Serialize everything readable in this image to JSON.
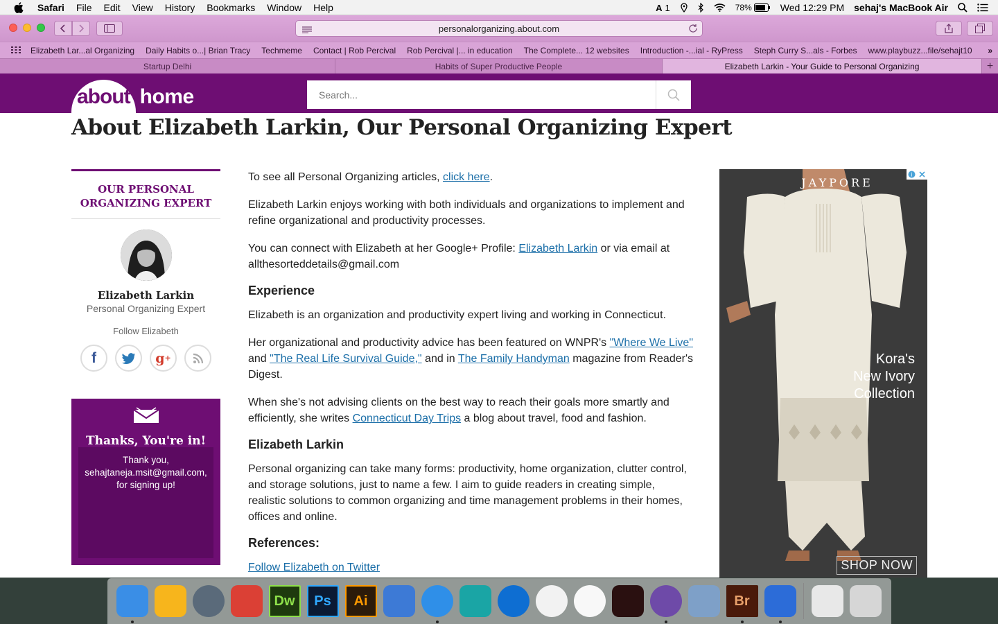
{
  "menubar": {
    "app": "Safari",
    "items": [
      "File",
      "Edit",
      "View",
      "History",
      "Bookmarks",
      "Window",
      "Help"
    ],
    "status": {
      "input_source": "1",
      "battery": "78%",
      "clock": "Wed 12:29 PM",
      "user": "sehaj's MacBook Air"
    }
  },
  "toolbar": {
    "url": "personalorganizing.about.com"
  },
  "bookmarks": [
    "Elizabeth Lar...al Organizing",
    "Daily Habits o...| Brian Tracy",
    "Techmeme",
    "Contact | Rob Percival",
    "Rob Percival |... in education",
    "The Complete... 12 websites",
    "Introduction -...ial - RyPress",
    "Steph Curry S...als - Forbes",
    "www.playbuzz...file/sehajt10"
  ],
  "tabs": [
    {
      "label": "Startup Delhi",
      "active": false
    },
    {
      "label": "Habits of Super Productive People",
      "active": false
    },
    {
      "label": "Elizabeth Larkin - Your Guide to Personal Organizing",
      "active": true
    }
  ],
  "site": {
    "logo_about": "about",
    "logo_home": "home",
    "search_placeholder": "Search...",
    "title": "About Elizabeth Larkin, Our Personal Organizing Expert"
  },
  "sidebar": {
    "heading": "OUR PERSONAL ORGANIZING EXPERT",
    "name": "Elizabeth Larkin",
    "role": "Personal Organizing Expert",
    "follow": "Follow Elizabeth",
    "social": [
      "facebook-icon",
      "twitter-icon",
      "google-plus-icon",
      "rss-icon"
    ],
    "newsletter_heading": "Thanks, You're in!",
    "newsletter_msg": "Thank you, sehajtaneja.msit@gmail.com, for signing up!"
  },
  "content": {
    "p1_pre": "To see all Personal Organizing articles, ",
    "p1_link": "click here",
    "p1_post": ".",
    "p2": "Elizabeth Larkin enjoys working with both individuals and organizations to implement and refine organizational and productivity processes.",
    "p3_pre": "You can connect with Elizabeth at her Google+ Profile: ",
    "p3_link": "Elizabeth Larkin",
    "p3_post": " or via email at allthesorteddetails@gmail.com",
    "h_experience": "Experience",
    "p4": "Elizabeth is an organization and productivity expert living and working in Connecticut.",
    "p5_pre": "Her organizational and productivity advice has been featured on WNPR's ",
    "p5_link1": "\"Where We Live\"",
    "p5_and": " and ",
    "p5_link2": "\"The Real Life Survival Guide,\"",
    "p5_mid": " and in ",
    "p5_link3": "The Family Handyman",
    "p5_post": " magazine from Reader's Digest.",
    "p6_pre": "When she's not advising clients on the best way to reach their goals more smartly and efficiently, she writes ",
    "p6_link": "Connecticut Day Trips",
    "p6_post": " a blog about travel, food and fashion.",
    "h_name": "Elizabeth Larkin",
    "p7": "Personal organizing can take many forms: productivity, home organization, clutter control, and storage solutions, just to name a few. I aim to guide readers in creating simple, realistic solutions to common organizing and time management problems in their homes, offices and online.",
    "h_refs": "References:",
    "ref1": "Follow Elizabeth on Twitter"
  },
  "ad": {
    "brand": "JAYPORE",
    "copy_line1": "Kora's",
    "copy_line2": "New Ivory",
    "copy_line3": "Collection",
    "cta": "SHOP NOW"
  },
  "dock": {
    "apps": [
      {
        "name": "finder-icon",
        "label": "",
        "color": "#3a8ee6"
      },
      {
        "name": "sketch-icon",
        "label": "",
        "color": "#f7b51c"
      },
      {
        "name": "launchpad-icon",
        "label": "",
        "color": "#5a6a7a"
      },
      {
        "name": "todoist-icon",
        "label": "",
        "color": "#db4035"
      },
      {
        "name": "dreamweaver-icon",
        "label": "Dw",
        "color": "#1e3a0e"
      },
      {
        "name": "photoshop-icon",
        "label": "Ps",
        "color": "#0b1a33"
      },
      {
        "name": "illustrator-icon",
        "label": "Ai",
        "color": "#2c1b0a"
      },
      {
        "name": "xcode-icon",
        "label": "",
        "color": "#3d7ad6"
      },
      {
        "name": "safari-icon",
        "label": "",
        "color": "#2f8fe8"
      },
      {
        "name": "maya-icon",
        "label": "",
        "color": "#1aa5a5"
      },
      {
        "name": "teamviewer-icon",
        "label": "",
        "color": "#0e6ed2"
      },
      {
        "name": "itunes-icon",
        "label": "",
        "color": "#f2f2f2"
      },
      {
        "name": "photos-icon",
        "label": "",
        "color": "#f8f8f8"
      },
      {
        "name": "podcast-app-icon",
        "label": "",
        "color": "#2a1010"
      },
      {
        "name": "github-icon",
        "label": "",
        "color": "#6e4aa8"
      },
      {
        "name": "preview-icon",
        "label": "",
        "color": "#7ea0c8"
      },
      {
        "name": "bridge-icon",
        "label": "Br",
        "color": "#4a1a0a"
      },
      {
        "name": "bluetooth-icon",
        "label": "",
        "color": "#2c6cd8"
      }
    ],
    "trailing": [
      {
        "name": "utorrent-file-icon",
        "label": "",
        "color": "#e8e8e8"
      },
      {
        "name": "trash-icon",
        "label": "",
        "color": "#d6d6d6"
      }
    ]
  }
}
